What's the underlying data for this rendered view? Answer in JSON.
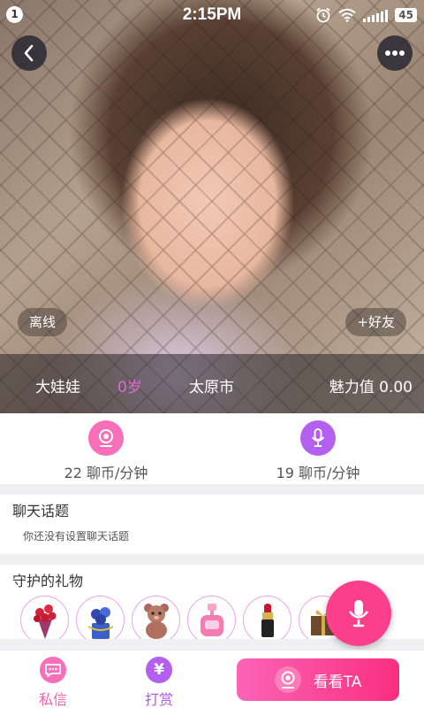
{
  "status_bar": {
    "notification_count": "1",
    "time": "2:15PM",
    "battery": "45",
    "icons": [
      "alarm-icon",
      "wifi-icon",
      "signal-icon",
      "battery-icon"
    ]
  },
  "profile": {
    "status": "离线",
    "add_friend": "+好友",
    "nickname": "大娃娃",
    "age": "0岁",
    "city": "太原市",
    "charm": "魅力值 0.00"
  },
  "rates": {
    "video": "22 聊币/分钟",
    "voice": "19 聊币/分钟"
  },
  "topics": {
    "title": "聊天话题",
    "empty_text": "你还没有设置聊天话题"
  },
  "gifts": {
    "title": "守护的礼物",
    "items": [
      "rose-bouquet-icon",
      "blue-rose-icon",
      "teddy-bear-icon",
      "perfume-icon",
      "lipstick-icon",
      "gift-box-icon"
    ]
  },
  "bottom_bar": {
    "message_label": "私信",
    "tip_label": "打赏",
    "tip_symbol": "¥",
    "watch_label": "看看TA"
  },
  "colors": {
    "pink": "#f76fb8",
    "purple": "#b35ff0",
    "accent": "#fa2e7e"
  }
}
